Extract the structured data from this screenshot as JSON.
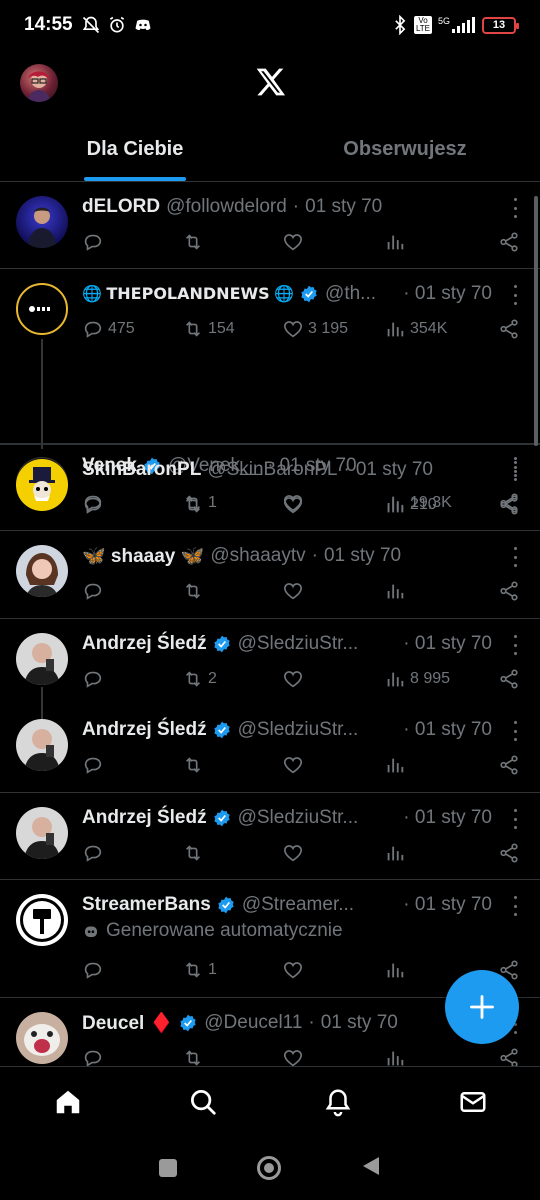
{
  "status_bar": {
    "time": "14:55",
    "network": "5G",
    "volte": "Vo LTE",
    "battery": "13"
  },
  "tabs": [
    {
      "label": "Dla Ciebie",
      "active": true
    },
    {
      "label": "Obserwujesz",
      "active": false
    }
  ],
  "colors": {
    "accent": "#1d9bf0",
    "background": "#000000",
    "muted": "#71767b",
    "text": "#e7e9ea"
  },
  "tweets": [
    {
      "name": "dELORD",
      "handle": "@followdelord",
      "sep": "·",
      "date": "01 sty 70",
      "verified": false,
      "replies": "",
      "retweets": "",
      "likes": "",
      "views": ""
    },
    {
      "name": "🌐 𝗧𝗛𝗘𝗣𝗢𝗟𝗔𝗡𝗗𝗡𝗘𝗪𝗦 🌐",
      "handle": "@th...",
      "sep": "·",
      "date": "01 sty 70",
      "verified": true,
      "replies": "475",
      "retweets": "154",
      "likes": "3 195",
      "views": "354K"
    },
    {
      "name": "Venek",
      "handle": "@Venek__",
      "sep": "·",
      "date": "01 sty 70",
      "verified": true,
      "replies": "",
      "retweets": "1",
      "likes": "",
      "views": "19,3K"
    },
    {
      "name": "SkinBaronPL",
      "handle": "@SkinBaronPL",
      "sep": "·",
      "date": "01 sty 70",
      "verified": false,
      "replies": "",
      "retweets": "",
      "likes": "",
      "views": "210"
    },
    {
      "name": "🦋 shaaay 🦋",
      "handle": "@shaaaytv",
      "sep": "·",
      "date": "01 sty 70",
      "verified": false,
      "replies": "",
      "retweets": "",
      "likes": "",
      "views": ""
    },
    {
      "name": "Andrzej Śledź",
      "handle": "@SledziuStr...",
      "sep": "·",
      "date": "01 sty 70",
      "verified": true,
      "replies": "",
      "retweets": "2",
      "likes": "",
      "views": "8 995"
    },
    {
      "name": "Andrzej Śledź",
      "handle": "@SledziuStr...",
      "sep": "·",
      "date": "01 sty 70",
      "verified": true,
      "replies": "",
      "retweets": "",
      "likes": "",
      "views": ""
    },
    {
      "name": "Andrzej Śledź",
      "handle": "@SledziuStr...",
      "sep": "·",
      "date": "01 sty 70",
      "verified": true,
      "replies": "",
      "retweets": "",
      "likes": "",
      "views": ""
    },
    {
      "name": "StreamerBans",
      "handle": "@Streamer...",
      "sep": "·",
      "date": "01 sty 70",
      "verified": true,
      "auto_label": "Generowane automatycznie",
      "replies": "",
      "retweets": "1",
      "likes": "",
      "views": ""
    },
    {
      "name": "Deucel ♦️",
      "handle": "@Deucel11",
      "sep": "·",
      "date": "01 sty 70",
      "verified": true,
      "replies": "",
      "retweets": "",
      "likes": "",
      "views": ""
    }
  ],
  "icons": {
    "logo": "x-logo-icon",
    "reply": "reply-icon",
    "retweet": "retweet-icon",
    "like": "heart-icon",
    "views": "views-icon",
    "share": "share-icon",
    "more": "more-icon",
    "compose": "plus-icon",
    "home": "home-icon",
    "search": "search-icon",
    "notifications": "bell-icon",
    "messages": "mail-icon"
  }
}
